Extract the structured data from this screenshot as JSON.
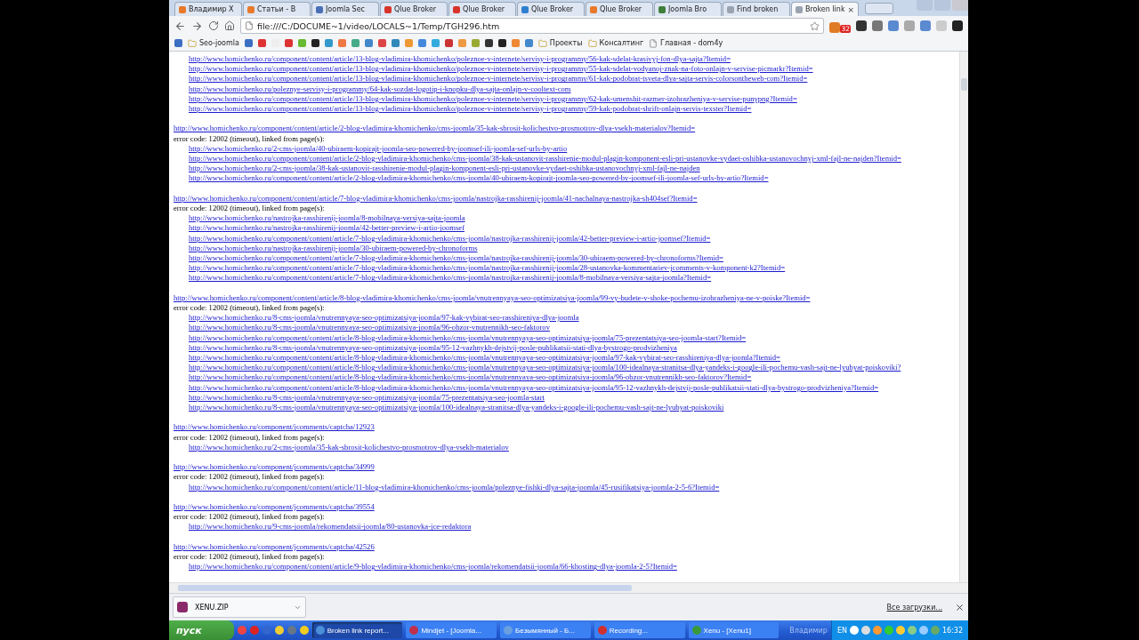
{
  "browser": {
    "tabs": [
      {
        "title": "Владимир Х",
        "selected": false,
        "color": "#e8792a"
      },
      {
        "title": "Статьи - В",
        "selected": false,
        "color": "#e8792a"
      },
      {
        "title": "Joomla Sec",
        "selected": false,
        "color": "#4a6fb5"
      },
      {
        "title": "Qlue Broker",
        "selected": false,
        "color": "#d9342b"
      },
      {
        "title": "Qlue Broker",
        "selected": false,
        "color": "#d9342b"
      },
      {
        "title": "Qlue Broker",
        "selected": false,
        "color": "#2f7fd0"
      },
      {
        "title": "Qlue Broker",
        "selected": false,
        "color": "#e8792a"
      },
      {
        "title": "Joomla Bro",
        "selected": false,
        "color": "#3f7f3a"
      },
      {
        "title": "Find broken",
        "selected": false,
        "color": "#9aa4b0"
      },
      {
        "title": "Broken link",
        "selected": true,
        "color": "#9aa4b0"
      }
    ],
    "tab_close": "×",
    "address": "file:///C:/DOCUME~1/video/LOCALS~1/Temp/TGH296.htm",
    "badge": "32",
    "bookmarks": [
      {
        "kind": "folder",
        "label": "Seo-joomla"
      },
      {
        "kind": "folder",
        "label": "Проекты"
      },
      {
        "kind": "folder",
        "label": "Консалтинг"
      },
      {
        "kind": "page",
        "label": "Главная - dom4y"
      }
    ]
  },
  "report": {
    "groups": [
      {
        "links": [
          "http://www.homichenko.ru/component/content/article/13-blog-vladimira-khomichenko/poleznoe-v-internete/servisy-i-programmy/56-kak-sdelat-krasivyj-fon-dlya-sajta?Itemid=",
          "http://www.homichenko.ru/component/content/article/13-blog-vladimira-khomichenko/poleznoe-v-internete/servisy-i-programmy/55-kak-sdelat-vodyanoj-znak-na-foto-onlajn-v-servise-picmarkr?Itemid=",
          "http://www.homichenko.ru/component/content/article/13-blog-vladimira-khomichenko/poleznoe-v-internete/servisy-i-programmy/61-kak-podobrat-tsveta-dlya-sajta-servis-colorsontheweb-com?Itemid=",
          "http://www.homichenko.ru/poleznye-servisy-i-programmy/64-kak-sozdat-logotip-i-knopku-dlya-sajta-onlajn-v-cooltext-com",
          "http://www.homichenko.ru/component/content/article/13-blog-vladimira-khomichenko/poleznoe-v-internete/servisy-i-programmy/62-kak-umenshit-razmer-izobrazheniya-v-servise-punypng?Itemid=",
          "http://www.homichenko.ru/component/content/article/13-blog-vladimira-khomichenko/poleznoe-v-internete/servisy-i-programmy/59-kak-podobrat-shrift-onlajn-servis-texster?Itemid="
        ]
      },
      {
        "url": "http://www.homichenko.ru/component/content/article/2-blog-vladimira-khomichenko/cms-joomla/35-kak-sbrosit-kolichestvo-prosmotrov-dlya-vsekh-materialov?Itemid=",
        "error": "error code: 12002 (timeout), linked from page(s):",
        "links": [
          "http://www.homichenko.ru/2-cms-joomla/40-ubiraem-kopirajt-joomla-seo-powered-by-joomsef-ili-joomla-sef-urls-by-artio",
          "http://www.homichenko.ru/component/content/article/2-blog-vladimira-khomichenko/cms-joomla/38-kak-ustanovit-rasshirenie-modul-plagin-komponent-esli-pri-ustanovke-vydaet-oshibka-ustanovochnyj-xml-fajl-ne-najden?Itemid=",
          "http://www.homichenko.ru/2-cms-joomla/38-kak-ustanovit-rasshirenie-modul-plagin-komponent-esli-pri-ustanovke-vydaet-oshibka-ustanovochnyj-xml-fajl-ne-najden",
          "http://www.homichenko.ru/component/content/article/2-blog-vladimira-khomichenko/cms-joomla/40-ubiraem-kopirajt-joomla-seo-powered-by-joomsef-ili-joomla-sef-urls-by-artio?Itemid="
        ]
      },
      {
        "url": "http://www.homichenko.ru/component/content/article/7-blog-vladimira-khomichenko/cms-joomla/nastrojka-rasshirenij-joomla/41-nachalnaya-nastrojka-sh404sef?Itemid=",
        "error": "error code: 12002 (timeout), linked from page(s):",
        "links": [
          "http://www.homichenko.ru/nastrojka-rasshirenij-joomla/8-mobilnaya-versiya-sajta-joomla",
          "http://www.homichenko.ru/nastrojka-rasshirenij-joomla/42-better-preview-i-artio-joomsef",
          "http://www.homichenko.ru/component/content/article/7-blog-vladimira-khomichenko/cms-joomla/nastrojka-rasshirenij-joomla/42-better-preview-i-artio-joomsef?Itemid=",
          "http://www.homichenko.ru/nastrojka-rasshirenij-joomla/30-ubiraem-powered-by-chronoforms",
          "http://www.homichenko.ru/component/content/article/7-blog-vladimira-khomichenko/cms-joomla/nastrojka-rasshirenij-joomla/30-ubiraem-powered-by-chronoforms?Itemid=",
          "http://www.homichenko.ru/component/content/article/7-blog-vladimira-khomichenko/cms-joomla/nastrojka-rasshirenij-joomla/28-ustanovka-kommentariev-jcomments-v-komponent-k2?Itemid=",
          "http://www.homichenko.ru/component/content/article/7-blog-vladimira-khomichenko/cms-joomla/nastrojka-rasshirenij-joomla/8-mobilnaya-versiya-sajta-joomla?Itemid="
        ]
      },
      {
        "url": "http://www.homichenko.ru/component/content/article/8-blog-vladimira-khomichenko/cms-joomla/vnutrennyaya-seo-optimizatsiya-joomla/99-vy-budete-v-shoke-pochemu-izobrazheniya-ne-v-poiske?Itemid=",
        "error": "error code: 12002 (timeout), linked from page(s):",
        "links": [
          "http://www.homichenko.ru/8-cms-joomla/vnutrennyaya-seo-optimizatsiya-joomla/97-kak-vybirat-seo-rasshireniya-dlya-joomla",
          "http://www.homichenko.ru/8-cms-joomla/vnutrennyaya-seo-optimizatsiya-joomla/96-obzor-vnutrennikh-seo-faktorov",
          "http://www.homichenko.ru/component/content/article/8-blog-vladimira-khomichenko/cms-joomla/vnutrennyaya-seo-optimizatsiya-joomla/75-prezentatsiya-seo-joomla-start?Itemid=",
          "http://www.homichenko.ru/8-cms-joomla/vnutrennyaya-seo-optimizatsiya-joomla/95-12-vazhnykh-dejstvij-posle-publikatsii-stati-dlya-bystrogo-prodvizheniya",
          "http://www.homichenko.ru/component/content/article/8-blog-vladimira-khomichenko/cms-joomla/vnutrennyaya-seo-optimizatsiya-joomla/97-kak-vybirat-seo-rasshireniya-dlya-joomla?Itemid=",
          "http://www.homichenko.ru/component/content/article/8-blog-vladimira-khomichenko/cms-joomla/vnutrennyaya-seo-optimizatsiya-joomla/100-idealnaya-stranitsa-dlya-yandeks-i-google-ili-pochemu-vash-sajt-ne-lyubyat-poiskoviki?",
          "http://www.homichenko.ru/component/content/article/8-blog-vladimira-khomichenko/cms-joomla/vnutrennyaya-seo-optimizatsiya-joomla/96-obzor-vnutrennikh-seo-faktorov?Itemid=",
          "http://www.homichenko.ru/component/content/article/8-blog-vladimira-khomichenko/cms-joomla/vnutrennyaya-seo-optimizatsiya-joomla/95-12-vazhnykh-dejstvij-posle-publikatsii-stati-dlya-bystrogo-prodvizheniya?Itemid=",
          "http://www.homichenko.ru/8-cms-joomla/vnutrennyaya-seo-optimizatsiya-joomla/75-prezentatsiya-seo-joomla-start",
          "http://www.homichenko.ru/8-cms-joomla/vnutrennyaya-seo-optimizatsiya-joomla/100-idealnaya-stranitsa-dlya-yandeks-i-google-ili-pochemu-vash-sajt-ne-lyubyat-poiskoviki"
        ]
      },
      {
        "url": "http://www.homichenko.ru/component/jcomments/captcha/12923",
        "error": "error code: 12002 (timeout), linked from page(s):",
        "links": [
          "http://www.homichenko.ru/2-cms-joomla/35-kak-sbrosit-kolichestvo-prosmotrov-dlya-vsekh-materialov"
        ]
      },
      {
        "url": "http://www.homichenko.ru/component/jcomments/captcha/34999",
        "error": "error code: 12002 (timeout), linked from page(s):",
        "links": [
          "http://www.homichenko.ru/component/content/article/11-blog-vladimira-khomichenko/cms-joomla/poleznye-fishki-dlya-sajta-joomla/45-rusifikatsiya-joomla-2-5-6?Itemid="
        ]
      },
      {
        "url": "http://www.homichenko.ru/component/jcomments/captcha/39554",
        "error": "error code: 12002 (timeout), linked from page(s):",
        "links": [
          "http://www.homichenko.ru/9-cms-joomla/rekomendatsii-joomla/80-ustanovka-jce-redaktora"
        ]
      },
      {
        "url": "http://www.homichenko.ru/component/jcomments/captcha/42526",
        "error": "error code: 12002 (timeout), linked from page(s):",
        "links": [
          "http://www.homichenko.ru/component/content/article/9-blog-vladimira-khomichenko/cms-joomla/rekomendatsii-joomla/66-khosting-dlya-joomla-2-5?Itemid="
        ]
      }
    ]
  },
  "downloads": {
    "file": "XENU.ZIP",
    "all": "Все загрузки..."
  },
  "taskbar": {
    "start": "пуск",
    "tasks": [
      {
        "title": "Broken link report...",
        "selected": true,
        "color": "#4a8fd8"
      },
      {
        "title": "Mindjet - [Joomla...",
        "selected": false,
        "color": "#c0304a"
      },
      {
        "title": "Безымянный - Б...",
        "selected": false,
        "color": "#6aa0e0"
      },
      {
        "title": "Recording...",
        "selected": false,
        "color": "#d03030"
      },
      {
        "title": "Xenu - [Xenu1]",
        "selected": false,
        "color": "#3a9a3a"
      }
    ],
    "user": "Владимир",
    "lang": "EN",
    "clock": "16:32"
  }
}
